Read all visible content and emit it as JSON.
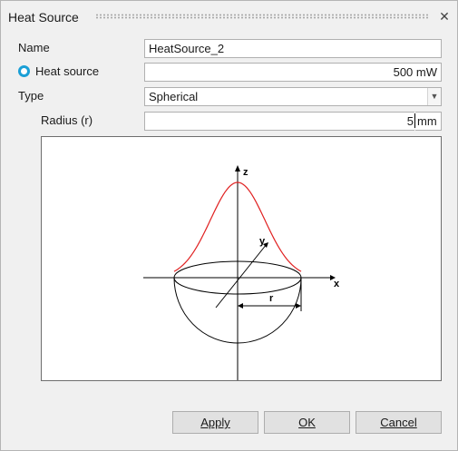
{
  "window": {
    "title": "Heat Source"
  },
  "form": {
    "name_label": "Name",
    "name_value": "HeatSource_2",
    "heat_label": "Heat source",
    "heat_value": "500 mW",
    "type_label": "Type",
    "type_value": "Spherical",
    "radius_label": "Radius (r)",
    "radius_value": "5",
    "radius_unit": "mm"
  },
  "diagram": {
    "axis_z": "z",
    "axis_y": "y",
    "axis_x": "x",
    "radius_symbol": "r",
    "curve_color": "#e02020"
  },
  "buttons": {
    "apply": "Apply",
    "ok": "OK",
    "cancel": "Cancel"
  }
}
